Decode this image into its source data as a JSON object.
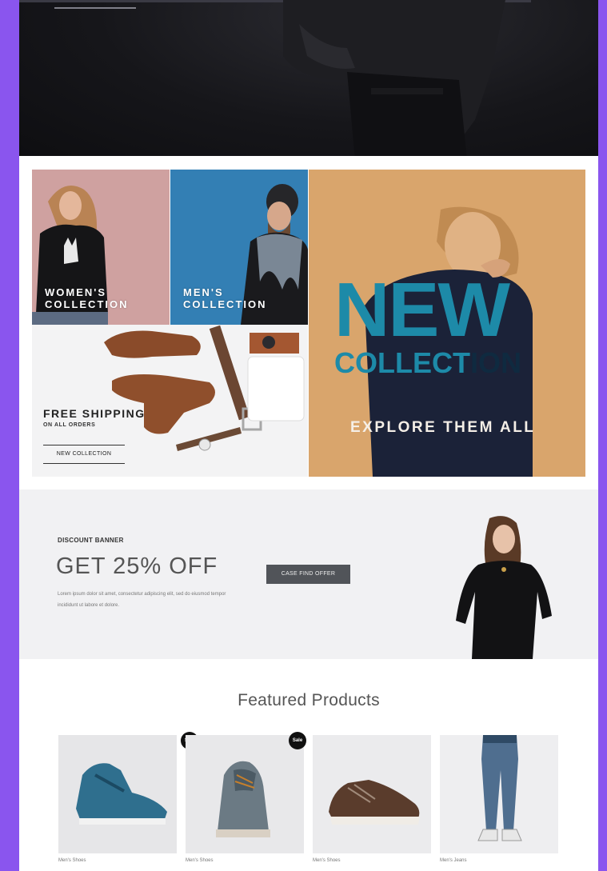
{
  "theme": {
    "frame": "#8a55ee",
    "accent_teal": "#1d8aa8",
    "button_dark": "#515459"
  },
  "collections": {
    "women": {
      "line1": "WOMEN'S",
      "line2": "COLLECTION"
    },
    "men": {
      "line1": "MEN'S",
      "line2": "COLLECTION"
    },
    "shipping": {
      "title": "FREE SHIPPING",
      "subtitle": "ON ALL ORDERS",
      "button": "NEW COLLECTION"
    },
    "new": {
      "big": "NEW",
      "coll_a": "COLLECT",
      "coll_b": "ION",
      "cta": "EXPLORE THEM ALL"
    }
  },
  "discount": {
    "label": "DISCOUNT BANNER",
    "title": "GET 25% OFF",
    "text": "Lorem ipsum dolor sit amet, consectetur adipiscing elit, sed do eiusmod tempor incididunt ut labore et dolore.",
    "button": "CASE FIND OFFER"
  },
  "featured": {
    "title": "Featured Products",
    "products": [
      {
        "name": "Men's Shoes",
        "badge": "Sale",
        "icon": "sneaker-blue-icon"
      },
      {
        "name": "Men's Shoes",
        "badge": "Sale",
        "icon": "shoe-grey-icon"
      },
      {
        "name": "Men's Shoes",
        "badge": "",
        "icon": "shoe-brown-icon"
      },
      {
        "name": "Men's Jeans",
        "badge": "",
        "icon": "jeans-icon"
      }
    ]
  }
}
